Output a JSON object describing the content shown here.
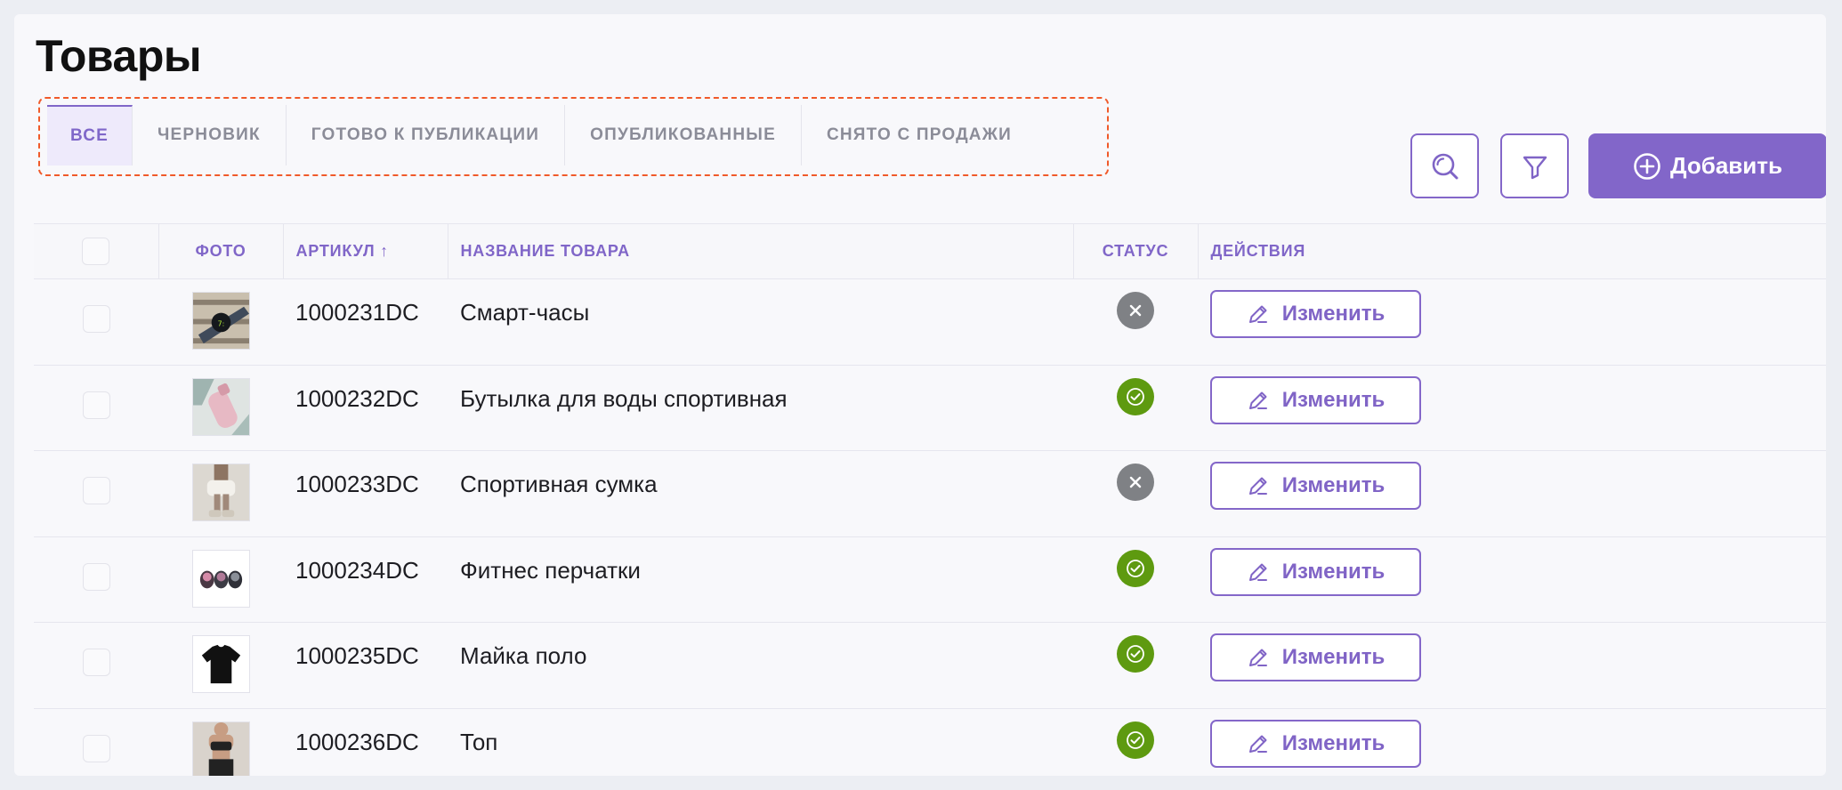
{
  "page": {
    "title": "Товары"
  },
  "tabs": [
    {
      "label": "ВСЕ",
      "active": true
    },
    {
      "label": "ЧЕРНОВИК",
      "active": false
    },
    {
      "label": "ГОТОВО К ПУБЛИКАЦИИ",
      "active": false
    },
    {
      "label": "ОПУБЛИКОВАННЫЕ",
      "active": false
    },
    {
      "label": "СНЯТО С ПРОДАЖИ",
      "active": false
    }
  ],
  "toolbar": {
    "search_icon": "search-icon",
    "filter_icon": "filter-icon",
    "add_label": "Добавить",
    "add_icon": "plus-circle-icon"
  },
  "table": {
    "columns": {
      "photo": "ФОТО",
      "sku": "АРТИКУЛ ↑",
      "name": "НАЗВАНИЕ ТОВАРА",
      "status": "СТАТУС",
      "actions": "ДЕЙСТВИЯ"
    },
    "rows": [
      {
        "sku": "1000231DC",
        "name": "Смарт-часы",
        "status": "inactive",
        "edit_label": "Изменить"
      },
      {
        "sku": "1000232DC",
        "name": "Бутылка для воды спортивная",
        "status": "active",
        "edit_label": "Изменить"
      },
      {
        "sku": "1000233DC",
        "name": "Спортивная сумка",
        "status": "inactive",
        "edit_label": "Изменить"
      },
      {
        "sku": "1000234DC",
        "name": "Фитнес перчатки",
        "status": "active",
        "edit_label": "Изменить"
      },
      {
        "sku": "1000235DC",
        "name": "Майка поло",
        "status": "active",
        "edit_label": "Изменить"
      },
      {
        "sku": "1000236DC",
        "name": "Топ",
        "status": "active",
        "edit_label": "Изменить"
      }
    ]
  },
  "colors": {
    "accent": "#8266c9",
    "status_active": "#5e9a10",
    "status_inactive": "#7f8185",
    "highlight": "#f05a2a"
  }
}
